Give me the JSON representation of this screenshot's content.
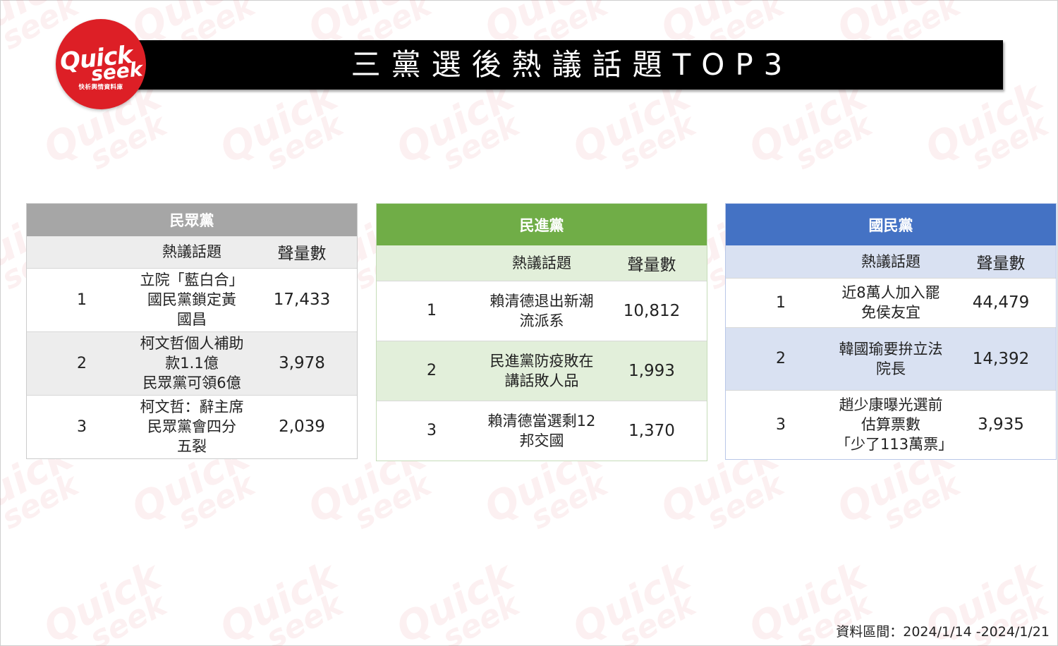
{
  "header": {
    "title": "三黨選後熱議話題TOP3",
    "logo": {
      "word1": "Quick",
      "word2": "seek",
      "subtitle": "快析輿情資料庫",
      "color": "#dd1f26"
    }
  },
  "watermark_text": {
    "line1": "Quick",
    "line2": "seek"
  },
  "tables": {
    "tpp": {
      "party": "民眾黨",
      "header_color": "#a6a6a6",
      "columns": {
        "topic": "熱議話題",
        "volume": "聲量數"
      },
      "rows": [
        {
          "rank": "1",
          "topic": "立院「藍白合」國民黨鎖定黃國昌",
          "volume": "17,433"
        },
        {
          "rank": "2",
          "topic": "柯文哲個人補助款1.1億民眾黨可領6億",
          "volume": "3,978"
        },
        {
          "rank": "3",
          "topic": "柯文哲：辭主席民眾黨會四分五裂",
          "volume": "2,039"
        }
      ]
    },
    "dpp": {
      "party": "民進黨",
      "header_color": "#70ad47",
      "columns": {
        "topic": "熱議話題",
        "volume": "聲量數"
      },
      "rows": [
        {
          "rank": "1",
          "topic": "賴清德退出新潮流派系",
          "volume": "10,812"
        },
        {
          "rank": "2",
          "topic": "民進黨防疫敗在講話敗人品",
          "volume": "1,993"
        },
        {
          "rank": "3",
          "topic": "賴清德當選剩12邦交國",
          "volume": "1,370"
        }
      ]
    },
    "kmt": {
      "party": "國民黨",
      "header_color": "#4472c4",
      "columns": {
        "topic": "熱議話題",
        "volume": "聲量數"
      },
      "rows": [
        {
          "rank": "1",
          "topic": "近8萬人加入罷免侯友宜",
          "volume": "44,479"
        },
        {
          "rank": "2",
          "topic": "韓國瑜要拚立法院長",
          "volume": "14,392"
        },
        {
          "rank": "3",
          "topic": "趙少康曝光選前估算票數「少了113萬票」",
          "volume": "3,935"
        }
      ]
    }
  },
  "footer": {
    "data_period": "資料區間：2024/1/14 -2024/1/21"
  }
}
